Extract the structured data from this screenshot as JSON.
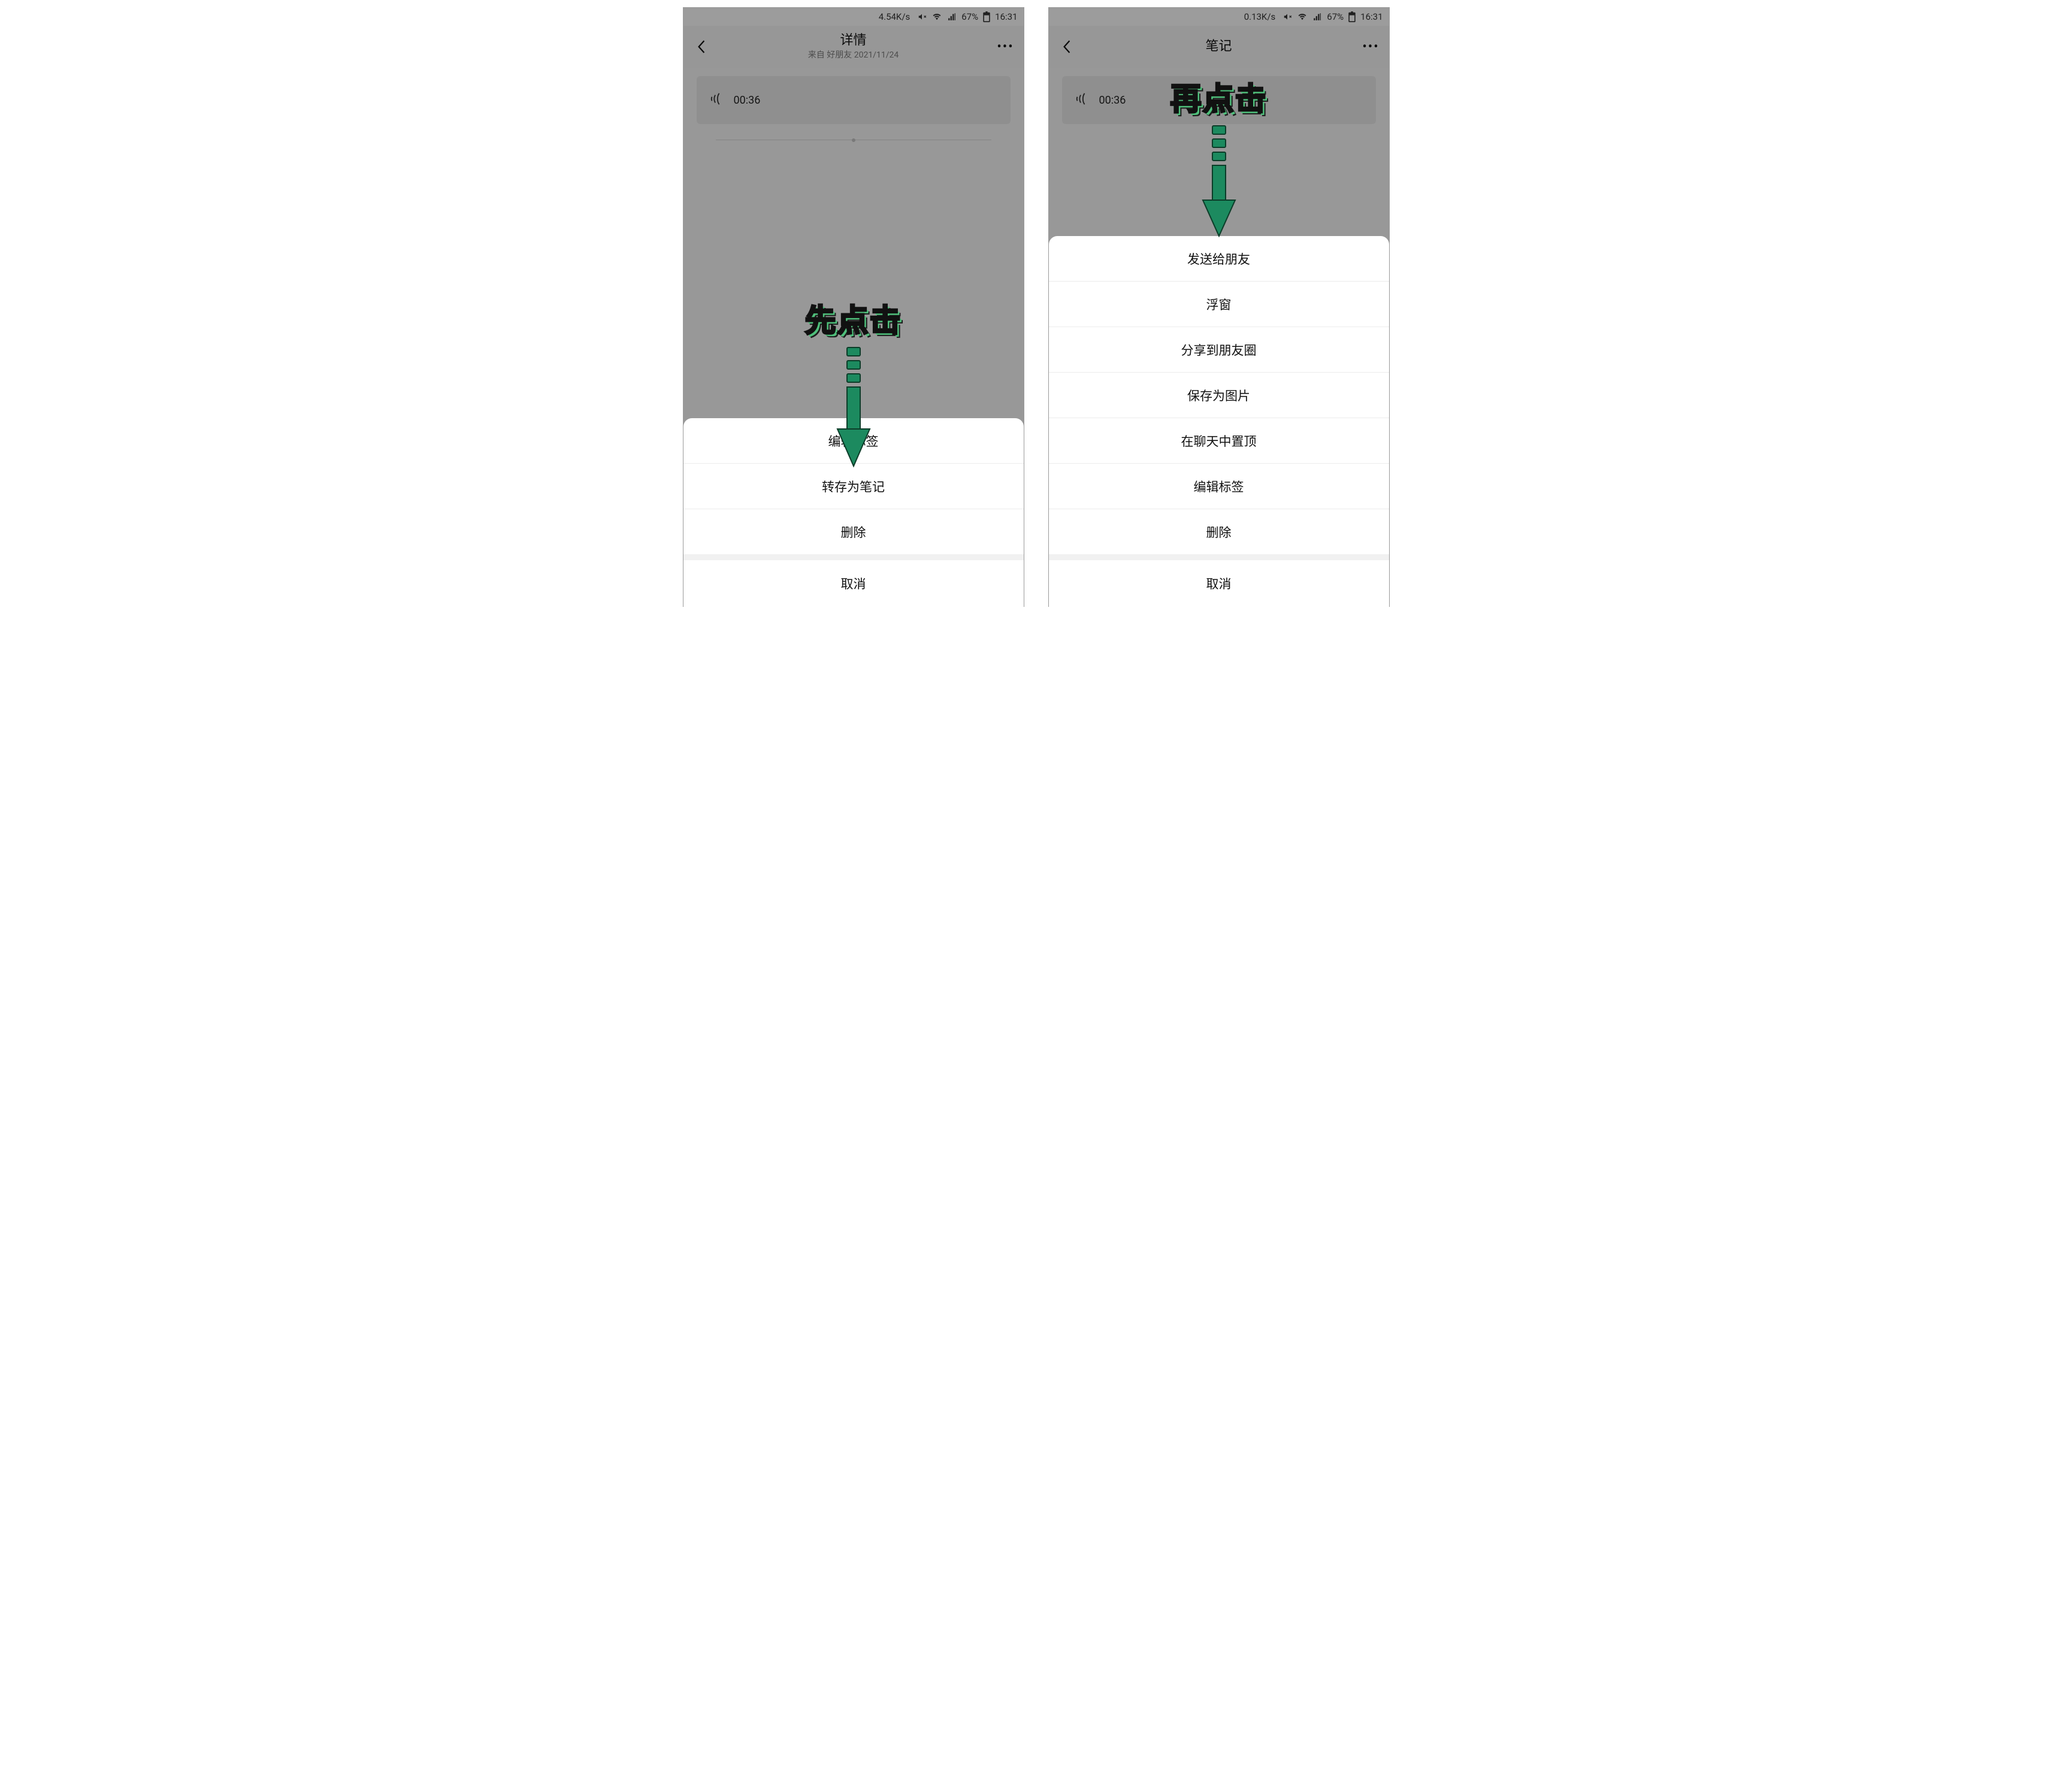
{
  "left": {
    "status": {
      "speed": "4.54K/s",
      "battery": "67%",
      "time": "16:31"
    },
    "header": {
      "title": "详情",
      "subtitle": "来自 好朋友 2021/11/24"
    },
    "voice": {
      "duration": "00:36"
    },
    "sheet": {
      "items": [
        "编辑标签",
        "转存为笔记",
        "删除"
      ],
      "cancel": "取消"
    },
    "annotation": {
      "label": "先点击"
    }
  },
  "right": {
    "status": {
      "speed": "0.13K/s",
      "battery": "67%",
      "time": "16:31"
    },
    "header": {
      "title": "笔记"
    },
    "voice": {
      "duration": "00:36"
    },
    "sheet": {
      "items": [
        "发送给朋友",
        "浮窗",
        "分享到朋友圈",
        "保存为图片",
        "在聊天中置顶",
        "编辑标签",
        "删除"
      ],
      "cancel": "取消"
    },
    "annotation": {
      "label": "再点击"
    }
  }
}
